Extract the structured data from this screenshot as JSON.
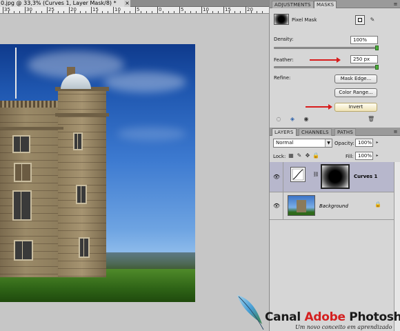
{
  "document": {
    "tab_title": "0.jpg @ 33,3% (Curves 1, Layer Mask/8) *",
    "close_glyph": "×",
    "ruler_numbers": [
      "35",
      "30",
      "25",
      "20",
      "15",
      "10",
      "5",
      "0",
      "5",
      "10",
      "15",
      "20"
    ]
  },
  "masks_panel": {
    "tabs": [
      {
        "label": "ADJUSTMENTS",
        "active": false
      },
      {
        "label": "MASKS",
        "active": true
      }
    ],
    "menu_glyph": "≡",
    "mask_type": "Pixel Mask",
    "density_label": "Density:",
    "density_value": "100%",
    "density_level": 1.0,
    "feather_label": "Feather:",
    "feather_value": "250 px",
    "feather_level": 1.0,
    "refine_label": "Refine:",
    "mask_edge_button": "Mask Edge...",
    "color_range_button": "Color Range...",
    "invert_button": "Invert",
    "arrow_color": "#d81b1b"
  },
  "layers_panel": {
    "tabs": [
      {
        "label": "LAYERS",
        "active": true
      },
      {
        "label": "CHANNELS",
        "active": false
      },
      {
        "label": "PATHS",
        "active": false
      }
    ],
    "menu_glyph": "≡",
    "blend_mode": "Normal",
    "opacity_label": "Opacity:",
    "opacity_value": "100%",
    "lock_label": "Lock:",
    "fill_label": "Fill:",
    "fill_value": "100%",
    "layers": [
      {
        "name": "Curves 1",
        "selected": true,
        "visible": true
      },
      {
        "name": "Background",
        "selected": false,
        "visible": true,
        "locked": true
      }
    ]
  },
  "watermark": {
    "brand_part1": "Canal ",
    "brand_part2": "Adobe",
    "brand_part3": " Photoshop",
    "tagline": "Um novo conceito em aprendizado",
    "accent_color": "#d42020"
  }
}
